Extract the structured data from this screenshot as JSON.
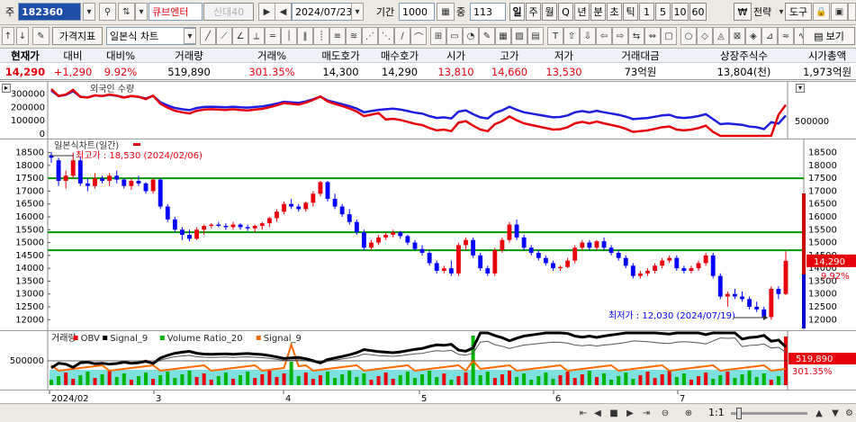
{
  "toolbar1": {
    "type_label": "주",
    "code": "182360",
    "name": "큐브엔터",
    "flags": "신대40",
    "date": "2024/07/23",
    "period_label": "기간",
    "period_value": "1000",
    "overlap_label": "중",
    "overlap_value": "113",
    "intervals": [
      "일",
      "주",
      "월",
      "Q",
      "년",
      "분",
      "초",
      "틱",
      "1",
      "5",
      "10",
      "60"
    ],
    "strategy_label": "전략",
    "tools_label": "도구"
  },
  "toolbar2": {
    "price_indicator_label": "가격지표",
    "chart_type": "일본식 차트",
    "view_label": "보기"
  },
  "quote": {
    "headers": [
      "현재가",
      "대비",
      "대비%",
      "거래량",
      "거래%",
      "매도호가",
      "매수호가",
      "시가",
      "고가",
      "저가",
      "거래대금",
      "상장주식수",
      "시가총액"
    ],
    "values": [
      "14,290",
      "+1,290",
      "9.92%",
      "519,890",
      "301.35%",
      "14,300",
      "14,290",
      "13,810",
      "14,660",
      "13,530",
      "73억원",
      "13,804(천)",
      "1,973억원"
    ]
  },
  "top_panel": {
    "legend": "외국인 수량",
    "y_ticks": [
      "300000",
      "200000",
      "100000",
      "0"
    ],
    "right_tick": "500000"
  },
  "price_panel": {
    "legend": "일본식차트(일간)",
    "high_note": "최고가 : 18,530 (2024/02/06)",
    "low_note": "최저가 : 12,030 (2024/07/19)",
    "current_price_tag": "14,290",
    "current_pct_tag": "9.92%",
    "y_ticks": [
      "18500",
      "18000",
      "17500",
      "17000",
      "16500",
      "16000",
      "15500",
      "15000",
      "14500",
      "14000",
      "13500",
      "13000",
      "12500",
      "12000"
    ]
  },
  "volume_panel": {
    "legend": [
      "거래량",
      "OBV",
      "Signal_9",
      "Volume Ratio_20",
      "Signal_9"
    ],
    "y_tick": "500000",
    "volume_tag": "519,890",
    "ratio_tag": "301.35%"
  },
  "x_axis": [
    "2024/02",
    "3",
    "4",
    "5",
    "6",
    "7"
  ],
  "status_bar": {
    "zoom": "1:1"
  },
  "chart_data": {
    "type": "candlestick",
    "period": "daily",
    "ylim": [
      11800,
      18800
    ],
    "support_lines": [
      17500,
      15400,
      14700
    ],
    "high": {
      "value": 18530,
      "date": "2024/02/06"
    },
    "low": {
      "value": 12030,
      "date": "2024/07/19"
    },
    "candles": [
      [
        18400,
        18530,
        18100,
        18300
      ],
      [
        18200,
        18300,
        17200,
        17400
      ],
      [
        17400,
        17800,
        17100,
        17600
      ],
      [
        17600,
        18500,
        17500,
        18200
      ],
      [
        18200,
        18350,
        17200,
        17300
      ],
      [
        17300,
        17500,
        17000,
        17200
      ],
      [
        17200,
        17700,
        17100,
        17500
      ],
      [
        17500,
        17600,
        17300,
        17400
      ],
      [
        17400,
        17700,
        17200,
        17600
      ],
      [
        17600,
        17800,
        17300,
        17450
      ],
      [
        17450,
        17500,
        17100,
        17200
      ],
      [
        17200,
        17500,
        17050,
        17400
      ],
      [
        17400,
        17600,
        17200,
        17300
      ],
      [
        17300,
        17350,
        16900,
        17000
      ],
      [
        17000,
        17500,
        16900,
        17450
      ],
      [
        17450,
        17500,
        16300,
        16400
      ],
      [
        16400,
        16500,
        15800,
        15900
      ],
      [
        15900,
        16000,
        15400,
        15500
      ],
      [
        15500,
        15600,
        15100,
        15300
      ],
      [
        15300,
        15500,
        15050,
        15150
      ],
      [
        15150,
        15600,
        15100,
        15500
      ],
      [
        15500,
        15700,
        15300,
        15650
      ],
      [
        15650,
        15750,
        15550,
        15700
      ],
      [
        15700,
        15800,
        15600,
        15650
      ],
      [
        15650,
        15750,
        15500,
        15600
      ],
      [
        15600,
        15800,
        15500,
        15700
      ],
      [
        15700,
        15750,
        15500,
        15600
      ],
      [
        15600,
        15700,
        15450,
        15550
      ],
      [
        15550,
        15700,
        15400,
        15650
      ],
      [
        15650,
        15800,
        15500,
        15750
      ],
      [
        15750,
        16000,
        15600,
        15950
      ],
      [
        15950,
        16300,
        15800,
        16200
      ],
      [
        16200,
        16600,
        16100,
        16500
      ],
      [
        16500,
        16700,
        16300,
        16400
      ],
      [
        16400,
        16500,
        16200,
        16300
      ],
      [
        16300,
        16600,
        16200,
        16550
      ],
      [
        16550,
        17000,
        16400,
        16900
      ],
      [
        16900,
        17400,
        16800,
        17350
      ],
      [
        17350,
        17400,
        16600,
        16700
      ],
      [
        16700,
        16900,
        16300,
        16400
      ],
      [
        16400,
        16500,
        16000,
        16100
      ],
      [
        16100,
        16300,
        15700,
        15800
      ],
      [
        15800,
        15900,
        15300,
        15400
      ],
      [
        15400,
        15500,
        14700,
        14800
      ],
      [
        14800,
        15100,
        14700,
        15000
      ],
      [
        15000,
        15300,
        14900,
        15200
      ],
      [
        15200,
        15400,
        15100,
        15300
      ],
      [
        15300,
        15500,
        15200,
        15400
      ],
      [
        15400,
        15450,
        15150,
        15250
      ],
      [
        15250,
        15300,
        14900,
        15000
      ],
      [
        15000,
        15100,
        14700,
        14750
      ],
      [
        14750,
        14900,
        14500,
        14600
      ],
      [
        14600,
        14700,
        14100,
        14200
      ],
      [
        14200,
        14300,
        13800,
        13900
      ],
      [
        13900,
        14100,
        13800,
        14000
      ],
      [
        14000,
        14300,
        13700,
        13800
      ],
      [
        13800,
        15000,
        13700,
        14900
      ],
      [
        14900,
        15200,
        14700,
        15100
      ],
      [
        15100,
        15200,
        14400,
        14500
      ],
      [
        14500,
        14600,
        13900,
        14000
      ],
      [
        14000,
        14100,
        13700,
        13800
      ],
      [
        13800,
        14800,
        13700,
        14700
      ],
      [
        14700,
        15200,
        14600,
        15100
      ],
      [
        15100,
        15800,
        15000,
        15700
      ],
      [
        15700,
        15900,
        15100,
        15200
      ],
      [
        15200,
        15300,
        14700,
        14800
      ],
      [
        14800,
        14900,
        14500,
        14600
      ],
      [
        14600,
        14700,
        14300,
        14400
      ],
      [
        14400,
        14500,
        14100,
        14200
      ],
      [
        14200,
        14300,
        13900,
        14000
      ],
      [
        14000,
        14100,
        13900,
        14050
      ],
      [
        14050,
        14400,
        14000,
        14300
      ],
      [
        14300,
        14900,
        14200,
        14800
      ],
      [
        14800,
        15100,
        14700,
        15000
      ],
      [
        15000,
        15100,
        14700,
        14800
      ],
      [
        14800,
        15100,
        14700,
        15050
      ],
      [
        15050,
        15200,
        14700,
        14800
      ],
      [
        14800,
        14900,
        14500,
        14600
      ],
      [
        14600,
        14700,
        14300,
        14400
      ],
      [
        14400,
        14500,
        14000,
        14100
      ],
      [
        14100,
        14200,
        13600,
        13700
      ],
      [
        13700,
        13900,
        13600,
        13800
      ],
      [
        13800,
        14000,
        13700,
        13900
      ],
      [
        13900,
        14200,
        13800,
        14100
      ],
      [
        14100,
        14400,
        14000,
        14300
      ],
      [
        14300,
        14500,
        14200,
        14400
      ],
      [
        14400,
        14500,
        13900,
        14000
      ],
      [
        14000,
        14100,
        13800,
        13900
      ],
      [
        13900,
        14100,
        13800,
        14000
      ],
      [
        14000,
        14300,
        13900,
        14200
      ],
      [
        14200,
        14600,
        14100,
        14500
      ],
      [
        14500,
        14600,
        13600,
        13700
      ],
      [
        13700,
        13800,
        12800,
        12900
      ],
      [
        12900,
        13100,
        12500,
        13000
      ],
      [
        13000,
        13200,
        12800,
        12900
      ],
      [
        12900,
        13100,
        12700,
        12800
      ],
      [
        12800,
        12900,
        12400,
        12500
      ],
      [
        12500,
        12700,
        12300,
        12400
      ],
      [
        12400,
        12500,
        12030,
        12100
      ],
      [
        12100,
        13300,
        12000,
        13200
      ],
      [
        13200,
        13300,
        12800,
        13000
      ],
      [
        13000,
        14660,
        12950,
        14290
      ]
    ],
    "foreign_holdings_series": "foreign quantity (red) and comparison line (blue)",
    "volume_series": [
      "거래량",
      "OBV",
      "Signal_9",
      "Volume Ratio_20",
      "Signal_9"
    ]
  }
}
